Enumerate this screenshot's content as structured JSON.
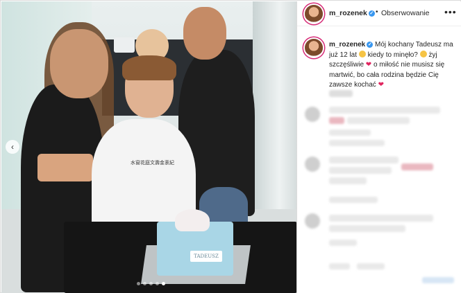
{
  "post": {
    "username": "m_rozenek",
    "verified_icon": "verified-badge-icon",
    "separator": "•",
    "follow_label": "Obserwowanie",
    "more_label": "•••",
    "caption_parts": [
      "Mój kochany Tadeusz ma już 12 lat ",
      " kiedy to minęło? ",
      " żyj szczęśliwie ",
      " o miłość nie musisz się martwić, bo cała rodzina będzie Cię zawsze kochać "
    ]
  },
  "photo": {
    "cake_text": "TADEUSZ",
    "shirt_text": "水窗花庭文壽金衷紀",
    "nav_prev_label": "‹",
    "slide_count": 5,
    "active_slide": 5
  },
  "colors": {
    "accent": "#3897f0",
    "heart": "#e0245e",
    "story_ring": "#d62976"
  }
}
